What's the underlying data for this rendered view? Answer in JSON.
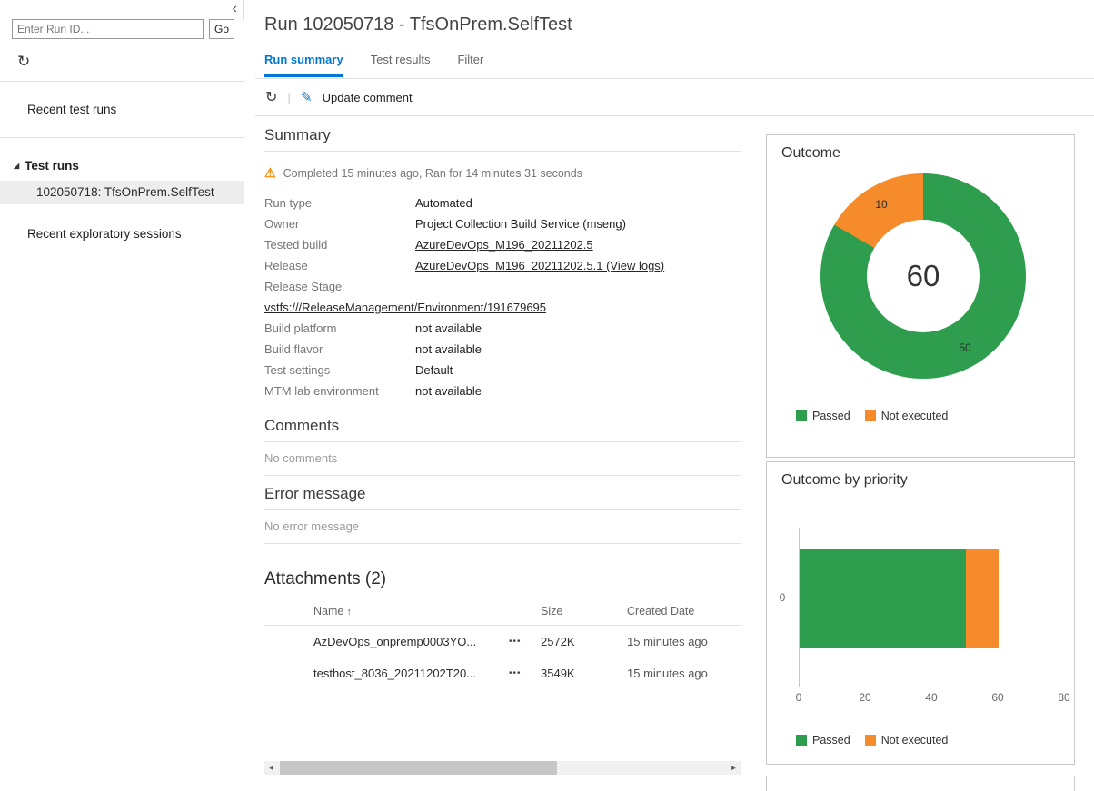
{
  "icons": {
    "collapse": "‹",
    "refresh": "↻",
    "tree_expanded": "◢",
    "edit": "✎",
    "separator": "|",
    "warning": "⚠",
    "sort_asc": "↑",
    "more": "•••",
    "scroll_left": "◄",
    "scroll_right": "►"
  },
  "colors": {
    "accent": "#0078d4",
    "passed": "#2e9e4e",
    "not_executed": "#f58b2b",
    "warning": "#ff8c00"
  },
  "sidebar": {
    "run_id_placeholder": "Enter Run ID...",
    "go_button": "Go",
    "recent_test_runs": "Recent test runs",
    "test_runs_header": "Test runs",
    "selected_run": "102050718: TfsOnPrem.SelfTest",
    "recent_exploratory_sessions": "Recent exploratory sessions"
  },
  "header": {
    "title": "Run 102050718 - TfsOnPrem.SelfTest",
    "tabs": [
      {
        "label": "Run summary",
        "active": true
      },
      {
        "label": "Test results",
        "active": false
      },
      {
        "label": "Filter",
        "active": false
      }
    ]
  },
  "toolbar": {
    "update_comment": "Update comment"
  },
  "summary": {
    "heading": "Summary",
    "status": "Completed 15 minutes ago, Ran for 14 minutes 31 seconds",
    "rows": [
      {
        "label": "Run type",
        "value": "Automated"
      },
      {
        "label": "Owner",
        "value": "Project Collection Build Service (mseng)"
      },
      {
        "label": "Tested build",
        "value": "AzureDevOps_M196_20211202.5"
      },
      {
        "label": "Release",
        "value": "AzureDevOps_M196_20211202.5.1 (View logs)"
      },
      {
        "label": "Release Stage",
        "value": ""
      },
      {
        "label": "",
        "value": "vstfs:///ReleaseManagement/Environment/191679695"
      },
      {
        "label": "Build platform",
        "value": "not available"
      },
      {
        "label": "Build flavor",
        "value": "not available"
      },
      {
        "label": "Test settings",
        "value": "Default"
      },
      {
        "label": "MTM lab environment",
        "value": "not available"
      }
    ]
  },
  "comments": {
    "heading": "Comments",
    "empty": "No comments"
  },
  "error": {
    "heading": "Error message",
    "empty": "No error message"
  },
  "attachments": {
    "heading": "Attachments (2)",
    "columns": [
      "Name",
      "Size",
      "Created Date"
    ],
    "rows": [
      {
        "name": "AzDevOps_onpremp0003YO...",
        "size": "2572K",
        "created": "15 minutes ago"
      },
      {
        "name": "testhost_8036_20211202T20...",
        "size": "3549K",
        "created": "15 minutes ago"
      }
    ]
  },
  "chart_data": [
    {
      "type": "pie",
      "title": "Outcome",
      "labels": [
        "Passed",
        "Not executed"
      ],
      "values": [
        50,
        10
      ],
      "total": 60,
      "colors": [
        "#2e9e4e",
        "#f58b2b"
      ],
      "legend": [
        "Passed",
        "Not executed"
      ],
      "legend_position": "bottom",
      "donut": true
    },
    {
      "type": "bar",
      "title": "Outcome by priority",
      "orientation": "horizontal",
      "stacked": true,
      "categories": [
        "0"
      ],
      "series": [
        {
          "name": "Passed",
          "values": [
            50
          ],
          "color": "#2e9e4e"
        },
        {
          "name": "Not executed",
          "values": [
            10
          ],
          "color": "#f58b2b"
        }
      ],
      "xlim": [
        0,
        80
      ],
      "xticks": [
        0,
        20,
        40,
        60,
        80
      ],
      "legend": [
        "Passed",
        "Not executed"
      ],
      "legend_position": "bottom",
      "grid": false
    }
  ]
}
